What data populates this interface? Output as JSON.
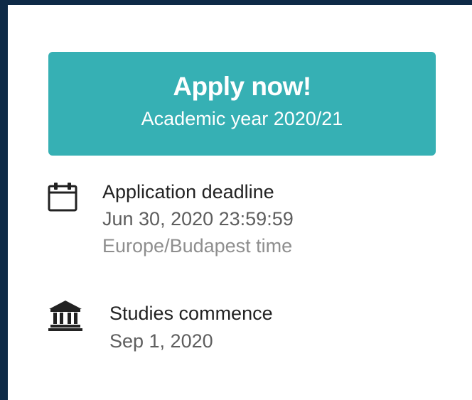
{
  "apply": {
    "title": "Apply now!",
    "subtitle": "Academic year 2020/21"
  },
  "deadline": {
    "icon": "calendar-icon",
    "label": "Application deadline",
    "date": "Jun 30, 2020 23:59:59",
    "timezone": "Europe/Budapest time"
  },
  "commence": {
    "icon": "institution-icon",
    "label": "Studies commence",
    "date": "Sep 1, 2020"
  },
  "colors": {
    "accent": "#36b0b4",
    "frame": "#0e2a47"
  }
}
